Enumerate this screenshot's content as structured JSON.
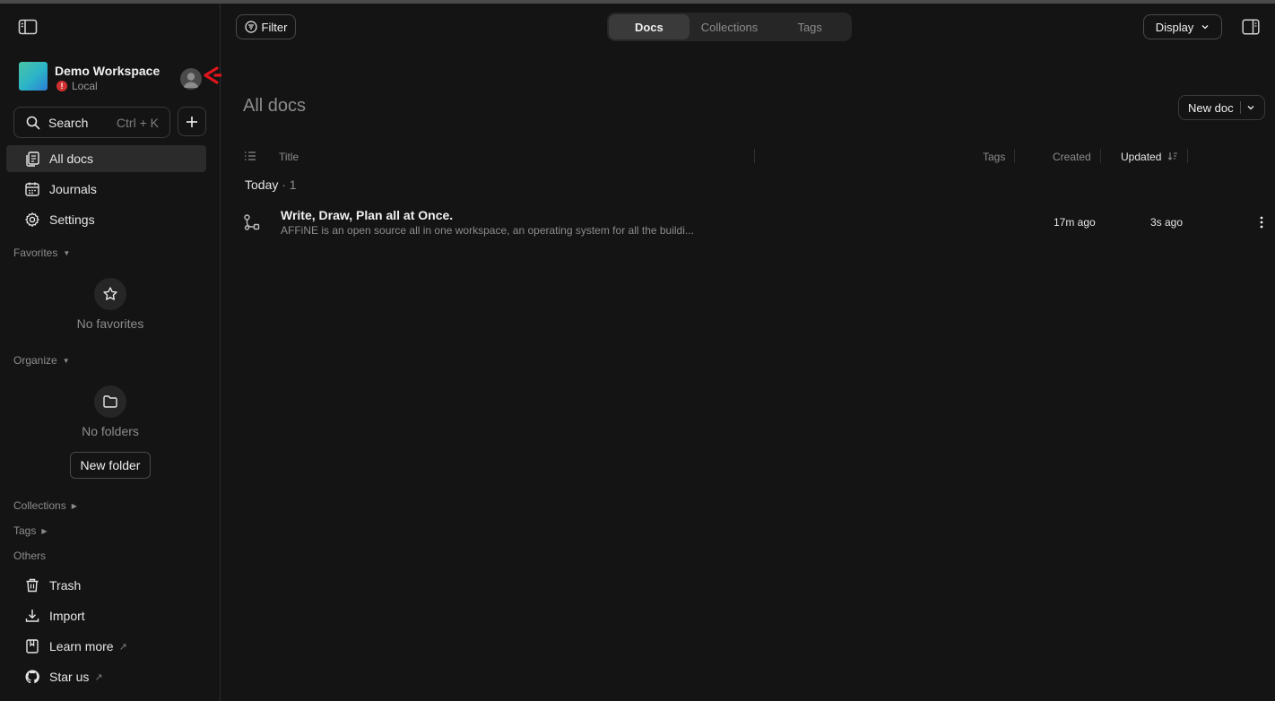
{
  "workspace": {
    "name": "Demo Workspace",
    "status": "Local",
    "status_icon": "alert-dot"
  },
  "search": {
    "label": "Search",
    "shortcut": "Ctrl + K"
  },
  "nav": [
    {
      "label": "All docs",
      "icon": "all-docs-icon",
      "active": true
    },
    {
      "label": "Journals",
      "icon": "calendar-icon"
    },
    {
      "label": "Settings",
      "icon": "gear-icon"
    }
  ],
  "favorites": {
    "title": "Favorites",
    "empty": "No favorites"
  },
  "organize": {
    "title": "Organize",
    "empty": "No folders",
    "new_folder": "New folder"
  },
  "sections": {
    "collections": "Collections",
    "tags": "Tags",
    "others": "Others"
  },
  "others": [
    {
      "label": "Trash",
      "icon": "trash-icon"
    },
    {
      "label": "Import",
      "icon": "import-icon"
    },
    {
      "label": "Learn more",
      "icon": "book-icon",
      "external": "↗"
    },
    {
      "label": "Star us",
      "icon": "github-icon",
      "external": "↗"
    }
  ],
  "toolbar": {
    "filter": "Filter",
    "tabs": [
      "Docs",
      "Collections",
      "Tags"
    ],
    "active_tab": "Docs",
    "display": "Display"
  },
  "page": {
    "title": "All docs",
    "new_doc": "New doc"
  },
  "table": {
    "headers": {
      "title": "Title",
      "tags": "Tags",
      "created": "Created",
      "updated": "Updated"
    },
    "group": {
      "label": "Today",
      "count": "· 1"
    },
    "rows": [
      {
        "title": "Write, Draw, Plan all at Once.",
        "preview": "AFFiNE is an open source all in one workspace, an operating system for all the buildi...",
        "created": "17m ago",
        "updated": "3s ago"
      }
    ]
  },
  "colors": {
    "background": "#141414",
    "active_item": "#2b2b2b",
    "annotation_arrow": "#e0141b"
  }
}
